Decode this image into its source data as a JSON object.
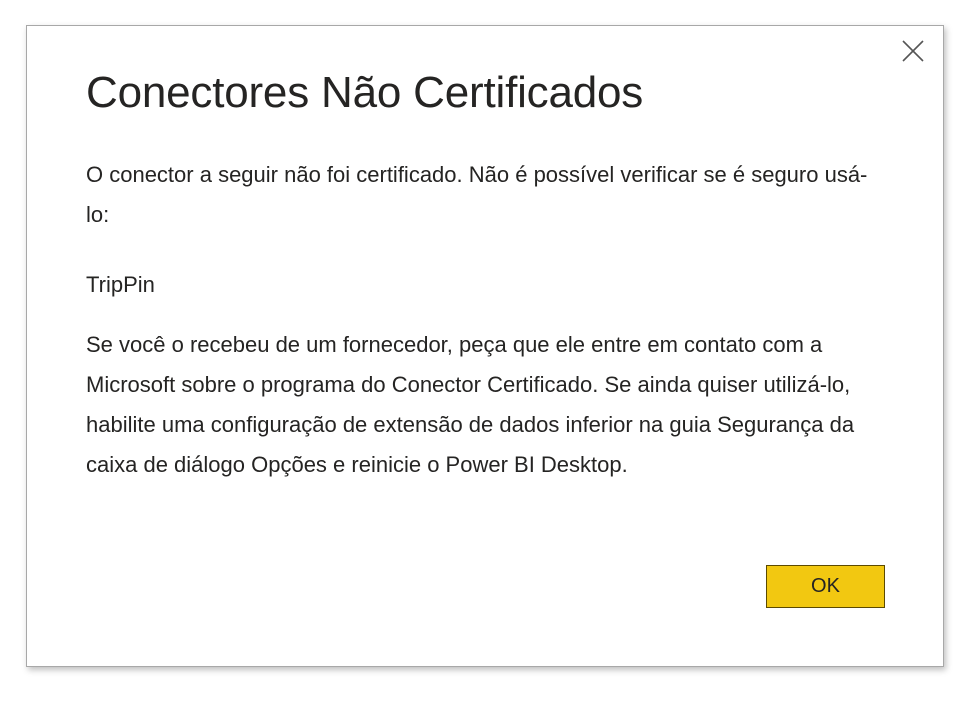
{
  "dialog": {
    "title": "Conectores Não Certificados",
    "close_icon": "close-icon",
    "intro": "O conector a seguir não foi certificado. Não é possível verificar se é seguro usá-lo:",
    "connector_name": "TripPin",
    "advice": "Se você o recebeu de um fornecedor, peça que ele entre em contato com a Microsoft sobre o programa do Conector Certificado. Se ainda quiser utilizá-lo, habilite uma configuração de extensão de dados inferior na guia Segurança da caixa de diálogo Opções e reinicie o Power BI Desktop.",
    "ok_label": "OK"
  },
  "colors": {
    "accent": "#f2c811",
    "text": "#252423",
    "border": "#a8a8a8"
  }
}
